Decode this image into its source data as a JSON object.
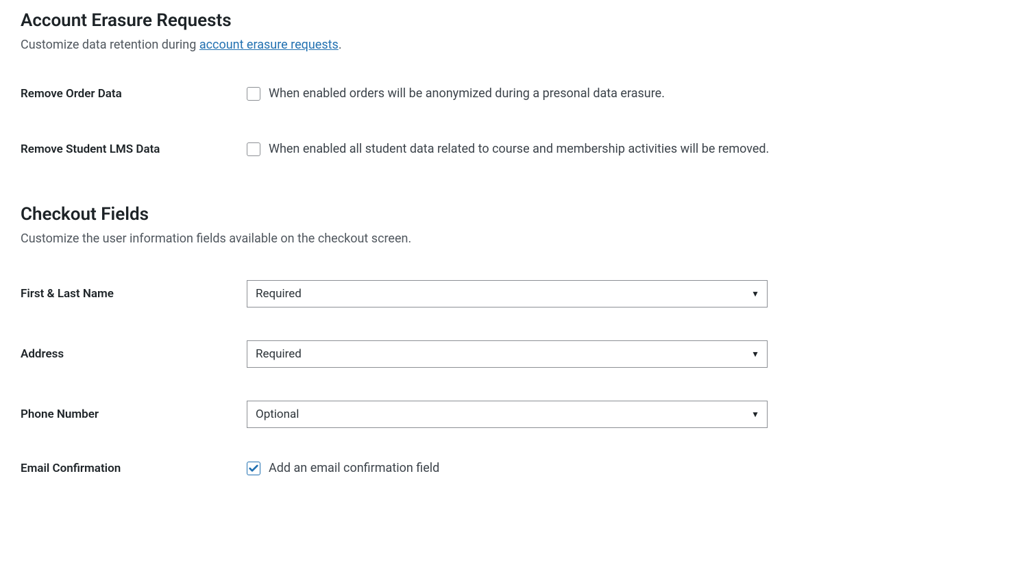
{
  "erasure": {
    "heading": "Account Erasure Requests",
    "desc_prefix": "Customize data retention during ",
    "desc_link": "account erasure requests",
    "desc_suffix": ".",
    "remove_order": {
      "label": "Remove Order Data",
      "text": "When enabled orders will be anonymized during a presonal data erasure.",
      "checked": false
    },
    "remove_lms": {
      "label": "Remove Student LMS Data",
      "text": "When enabled all student data related to course and membership activities will be removed.",
      "checked": false
    }
  },
  "checkout": {
    "heading": "Checkout Fields",
    "desc": "Customize the user information fields available on the checkout screen.",
    "first_last_name": {
      "label": "First & Last Name",
      "value": "Required"
    },
    "address": {
      "label": "Address",
      "value": "Required"
    },
    "phone": {
      "label": "Phone Number",
      "value": "Optional"
    },
    "email_confirm": {
      "label": "Email Confirmation",
      "text": "Add an email confirmation field",
      "checked": true
    }
  }
}
